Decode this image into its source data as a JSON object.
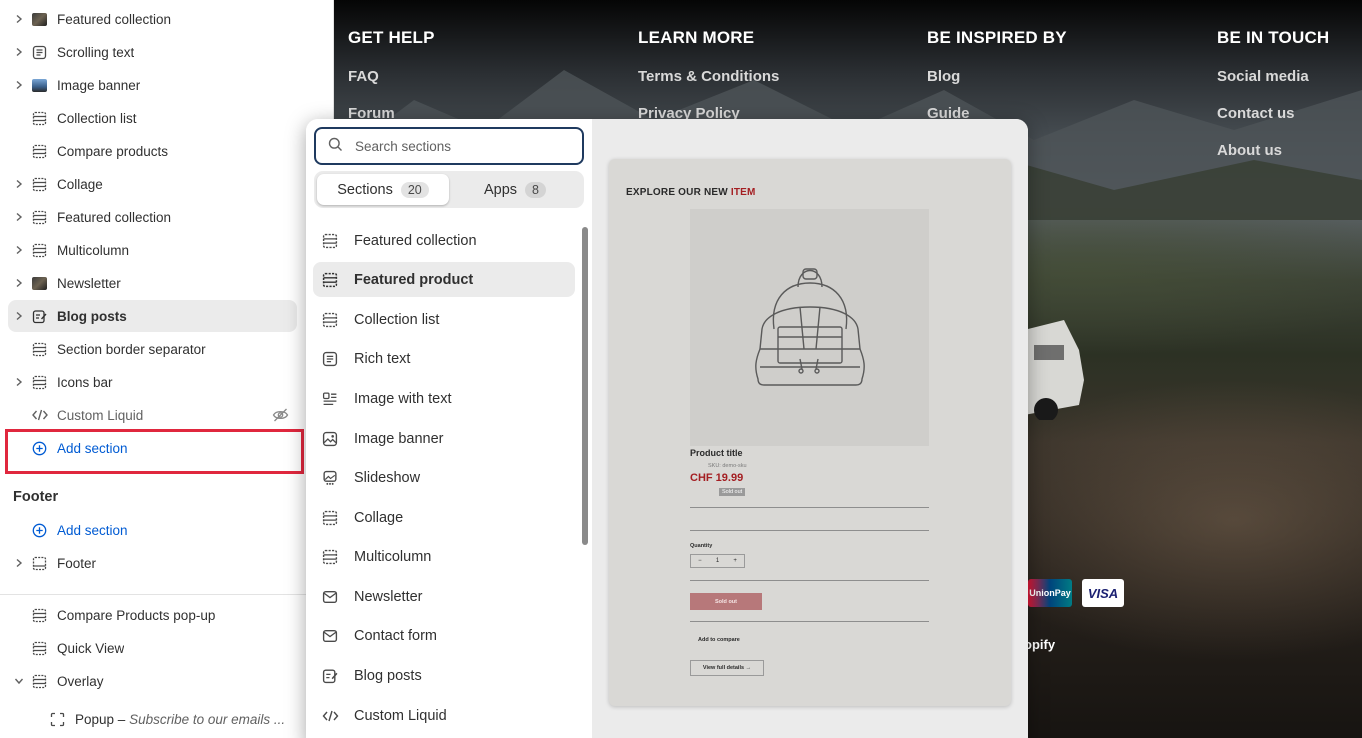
{
  "sidebar": {
    "items": [
      {
        "label": "Featured collection",
        "icon": "image-thumbnail-icon",
        "chevron": true
      },
      {
        "label": "Scrolling text",
        "icon": "text-block-icon",
        "chevron": true
      },
      {
        "label": "Image banner",
        "icon": "image-thumbnail-icon",
        "chevron": true
      },
      {
        "label": "Collection list",
        "icon": "section-layout-icon",
        "chevron": false
      },
      {
        "label": "Compare products",
        "icon": "section-layout-icon",
        "chevron": false
      },
      {
        "label": "Collage",
        "icon": "section-layout-icon",
        "chevron": true
      },
      {
        "label": "Featured collection",
        "icon": "section-layout-icon",
        "chevron": true
      },
      {
        "label": "Multicolumn",
        "icon": "section-layout-icon",
        "chevron": true
      },
      {
        "label": "Newsletter",
        "icon": "image-thumbnail-icon",
        "chevron": true
      },
      {
        "label": "Blog posts",
        "icon": "edit-post-icon",
        "chevron": true
      },
      {
        "label": "Section border separator",
        "icon": "section-layout-icon",
        "chevron": false
      },
      {
        "label": "Icons bar",
        "icon": "section-layout-icon",
        "chevron": true
      },
      {
        "label": "Custom Liquid",
        "icon": "code-icon",
        "chevron": false
      }
    ],
    "add_section_label": "Add section",
    "footer_title": "Footer",
    "footer_add_section_label": "Add section",
    "footer_item": "Footer",
    "overlay_items": [
      {
        "label": "Compare Products pop-up"
      },
      {
        "label": "Quick View"
      },
      {
        "label": "Overlay"
      }
    ],
    "popup": {
      "label": "Popup",
      "separator": " – ",
      "detail": "Subscribe to our emails ..."
    }
  },
  "storefront": {
    "columns": [
      {
        "title": "GET HELP",
        "links": [
          "FAQ",
          "Forum"
        ]
      },
      {
        "title": "LEARN MORE",
        "links": [
          "Terms & Conditions",
          "Privacy Policy"
        ]
      },
      {
        "title": "BE INSPIRED BY",
        "links": [
          "Blog",
          "Guide"
        ]
      },
      {
        "title": "BE IN TOUCH",
        "links": [
          "Social media",
          "Contact us",
          "About us"
        ]
      }
    ],
    "payment_unionpay": "UnionPay",
    "payment_visa": "VISA",
    "powered_by": "opify"
  },
  "picker": {
    "search": {
      "placeholder": "Search sections",
      "value": ""
    },
    "tabs": [
      {
        "label": "Sections",
        "count": "20"
      },
      {
        "label": "Apps",
        "count": "8"
      }
    ],
    "items": [
      {
        "label": "Featured collection",
        "icon": "section-layout-icon"
      },
      {
        "label": "Featured product",
        "icon": "section-layout-icon"
      },
      {
        "label": "Collection list",
        "icon": "section-layout-icon"
      },
      {
        "label": "Rich text",
        "icon": "text-block-icon"
      },
      {
        "label": "Image with text",
        "icon": "image-with-text-icon"
      },
      {
        "label": "Image banner",
        "icon": "image-icon"
      },
      {
        "label": "Slideshow",
        "icon": "slideshow-icon"
      },
      {
        "label": "Collage",
        "icon": "section-layout-icon"
      },
      {
        "label": "Multicolumn",
        "icon": "section-layout-icon"
      },
      {
        "label": "Newsletter",
        "icon": "email-icon"
      },
      {
        "label": "Contact form",
        "icon": "email-icon"
      },
      {
        "label": "Blog posts",
        "icon": "edit-post-icon"
      },
      {
        "label": "Custom Liquid",
        "icon": "code-icon"
      }
    ],
    "hovered_index": 1,
    "preview": {
      "heading": "EXPLORE OUR NEW ",
      "heading_accent": "ITEM",
      "product_title": "Product title",
      "sku": "SKU: demo-sku",
      "price": "CHF 19.99",
      "badge": "Sold out",
      "quantity_label": "Quantity",
      "qty_minus": "−",
      "qty_value": "1",
      "qty_plus": "+",
      "sold_out_button": "Sold out",
      "compare": "Add to compare",
      "details": "View full details →"
    }
  },
  "colors": {
    "accent_link": "#005bd3",
    "highlight": "#e0273e",
    "price": "#a41e22"
  }
}
